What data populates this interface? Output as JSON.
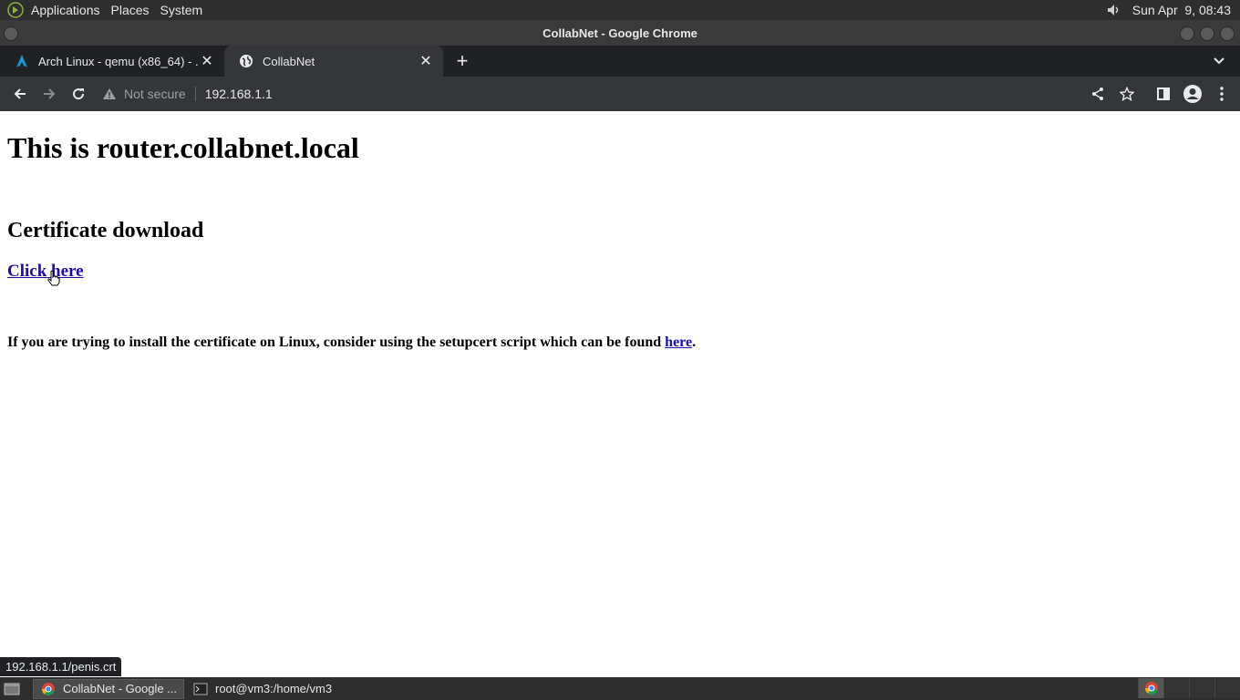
{
  "top_panel": {
    "menus": [
      "Applications",
      "Places",
      "System"
    ],
    "clock": "Sun Apr  9, 08:43"
  },
  "window": {
    "title": "CollabNet - Google Chrome"
  },
  "tabs": [
    {
      "title": "Arch Linux - qemu (x86_64) - ...",
      "icon": "arch-icon"
    },
    {
      "title": "CollabNet",
      "icon": "globe-icon",
      "active": true
    }
  ],
  "toolbar": {
    "security_label": "Not secure",
    "url": "192.168.1.1"
  },
  "page": {
    "heading": "This is router.collabnet.local",
    "subheading": "Certificate download",
    "link_text": "Click here",
    "info_text": "If you are trying to install the certificate on Linux, consider using the setupcert script which can be found ",
    "info_link": "here",
    "info_end": "."
  },
  "status_url": "192.168.1.1/penis.crt",
  "taskbar": {
    "items": [
      {
        "label": "CollabNet - Google ...",
        "icon": "chrome-icon",
        "active": true
      },
      {
        "label": "root@vm3:/home/vm3",
        "icon": "terminal-icon",
        "active": false
      }
    ]
  },
  "colors": {
    "link": "#1a0dab",
    "chrome_dark": "#202124",
    "toolbar": "#35363a"
  }
}
